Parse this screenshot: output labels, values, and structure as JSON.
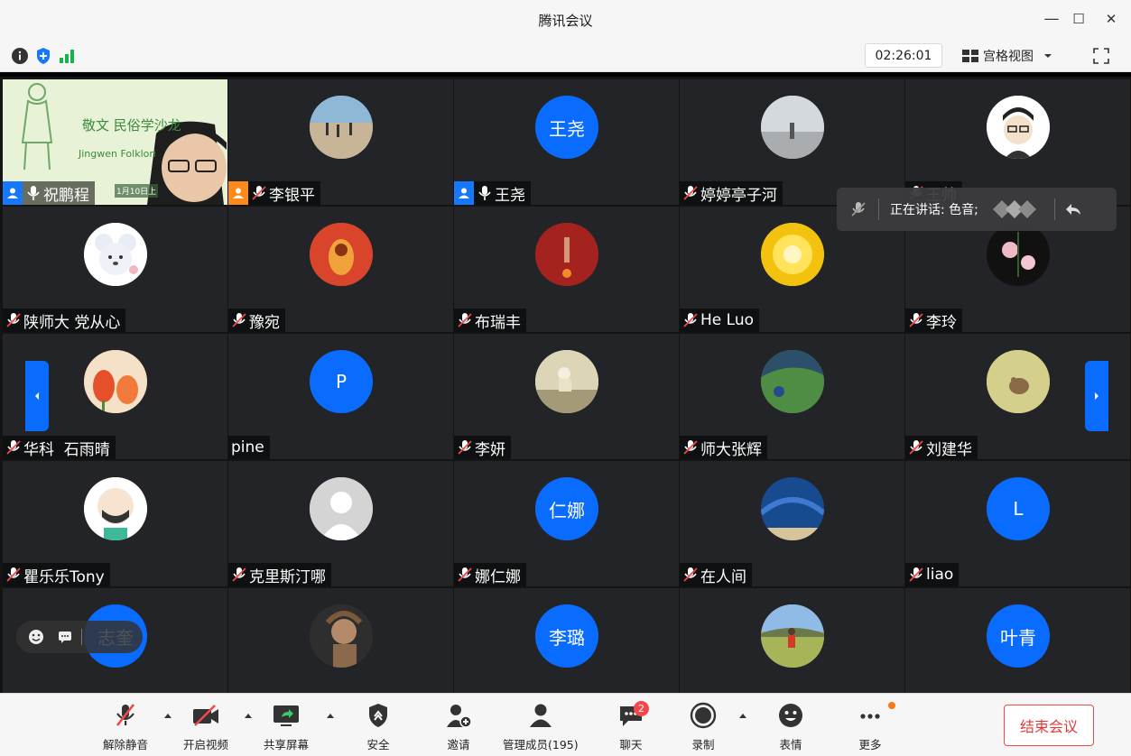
{
  "window": {
    "title": "腾讯会议",
    "minimize": "—",
    "maximize": "☐",
    "close": "✕"
  },
  "toolbar": {
    "timer": "02:26:01",
    "view_label": "宫格视图"
  },
  "participants": [
    {
      "name": "祝鹏程",
      "avatar_text": "",
      "role": "host",
      "mic": "on"
    },
    {
      "name": "李银平",
      "avatar_text": "",
      "role": "cohost",
      "mic": "off"
    },
    {
      "name": "王尧",
      "avatar_text": "王尧",
      "role": "host",
      "mic": "on"
    },
    {
      "name": "婷婷亭子河",
      "avatar_text": "",
      "role": "",
      "mic": "off"
    },
    {
      "name": "王帅",
      "avatar_text": "",
      "role": "",
      "mic": "off"
    },
    {
      "name": "陕师大 党从心",
      "avatar_text": "",
      "role": "",
      "mic": "off"
    },
    {
      "name": "豫宛",
      "avatar_text": "",
      "role": "",
      "mic": "off"
    },
    {
      "name": "布瑞丰",
      "avatar_text": "",
      "role": "",
      "mic": "off"
    },
    {
      "name": "He Luo",
      "avatar_text": "",
      "role": "",
      "mic": "off"
    },
    {
      "name": "李玲",
      "avatar_text": "",
      "role": "",
      "mic": "off"
    },
    {
      "name": "华科  石雨晴",
      "avatar_text": "",
      "role": "",
      "mic": "off"
    },
    {
      "name": "pine",
      "avatar_text": "P",
      "role": "",
      "mic": "none"
    },
    {
      "name": "李妍",
      "avatar_text": "",
      "role": "",
      "mic": "off"
    },
    {
      "name": "师大张辉",
      "avatar_text": "",
      "role": "",
      "mic": "off"
    },
    {
      "name": "刘建华",
      "avatar_text": "",
      "role": "",
      "mic": "off"
    },
    {
      "name": "瞿乐乐Tony",
      "avatar_text": "",
      "role": "",
      "mic": "off"
    },
    {
      "name": "克里斯汀哪",
      "avatar_text": "",
      "role": "",
      "mic": "off"
    },
    {
      "name": "娜仁娜",
      "avatar_text": "仁娜",
      "role": "",
      "mic": "off"
    },
    {
      "name": "在人间",
      "avatar_text": "",
      "role": "",
      "mic": "off"
    },
    {
      "name": "liao",
      "avatar_text": "L",
      "role": "",
      "mic": "off"
    },
    {
      "name": "",
      "avatar_text": "志奎",
      "role": "",
      "mic": "off"
    },
    {
      "name": "",
      "avatar_text": "",
      "role": "",
      "mic": "off"
    },
    {
      "name": "",
      "avatar_text": "李璐",
      "role": "",
      "mic": "off"
    },
    {
      "name": "",
      "avatar_text": "",
      "role": "",
      "mic": "off"
    },
    {
      "name": "",
      "avatar_text": "叶青",
      "role": "",
      "mic": "off"
    }
  ],
  "share_banner": {
    "line1": "敬文 民俗学沙龙",
    "line2": "Jingwen Folklori",
    "date": "1月10日上"
  },
  "speaking": {
    "label": "正在讲话: 色音;"
  },
  "bottombar": {
    "items": [
      {
        "label": "解除静音"
      },
      {
        "label": "开启视频"
      },
      {
        "label": "共享屏幕"
      },
      {
        "label": "安全"
      },
      {
        "label": "邀请"
      },
      {
        "label": "管理成员(195)"
      },
      {
        "label": "聊天"
      },
      {
        "label": "录制"
      },
      {
        "label": "表情"
      },
      {
        "label": "更多"
      }
    ],
    "chat_badge": "2",
    "end_label": "结束会议"
  },
  "colors": {
    "accent": "#0a6cff",
    "end": "#e23a3a",
    "tile_bg": "#232427"
  }
}
